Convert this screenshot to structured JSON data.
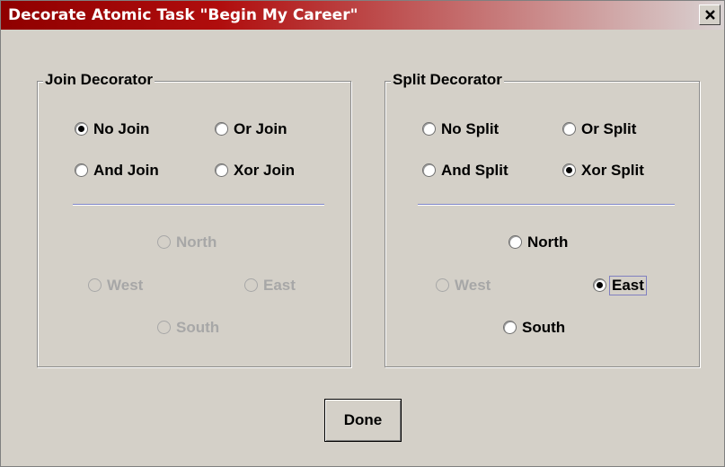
{
  "window": {
    "title": "Decorate Atomic Task \"Begin My Career\"",
    "close_icon": "close-icon"
  },
  "join_decorator": {
    "title": "Join Decorator",
    "types": [
      {
        "label": "No Join",
        "selected": true
      },
      {
        "label": "Or Join",
        "selected": false
      },
      {
        "label": "And Join",
        "selected": false
      },
      {
        "label": "Xor Join",
        "selected": false
      }
    ],
    "positions": [
      {
        "label": "North",
        "selected": false,
        "enabled": false
      },
      {
        "label": "West",
        "selected": false,
        "enabled": false
      },
      {
        "label": "East",
        "selected": false,
        "enabled": false
      },
      {
        "label": "South",
        "selected": false,
        "enabled": false
      }
    ]
  },
  "split_decorator": {
    "title": "Split Decorator",
    "types": [
      {
        "label": "No Split",
        "selected": false
      },
      {
        "label": "Or Split",
        "selected": false
      },
      {
        "label": "And Split",
        "selected": false
      },
      {
        "label": "Xor Split",
        "selected": true
      }
    ],
    "positions": [
      {
        "label": "North",
        "selected": false,
        "enabled": true
      },
      {
        "label": "West",
        "selected": false,
        "enabled": false
      },
      {
        "label": "East",
        "selected": true,
        "enabled": true
      },
      {
        "label": "South",
        "selected": false,
        "enabled": true
      }
    ]
  },
  "footer": {
    "done_label": "Done"
  },
  "colors": {
    "title_bar": "#8f0000",
    "dialog_bg": "#d4d0c8",
    "separator": "#7f86c9",
    "disabled_text": "#a7a7a7"
  }
}
